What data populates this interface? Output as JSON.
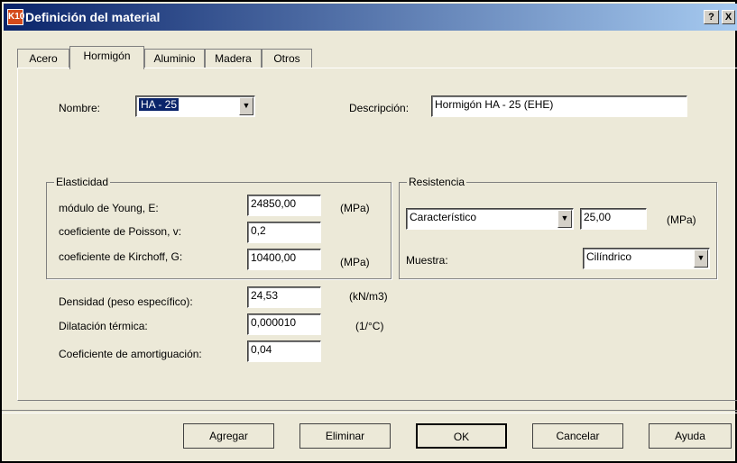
{
  "window": {
    "title": "Definición del material",
    "icon_text": "K10",
    "help_label": "?",
    "close_label": "X"
  },
  "tabs": [
    {
      "label": "Acero"
    },
    {
      "label": "Hormigón",
      "active": true
    },
    {
      "label": "Aluminio"
    },
    {
      "label": "Madera"
    },
    {
      "label": "Otros"
    }
  ],
  "nombre": {
    "label": "Nombre:",
    "value": "HA - 25"
  },
  "descripcion": {
    "label": "Descripción:",
    "value": "Hormigón HA - 25 (EHE)"
  },
  "elasticidad": {
    "title": "Elasticidad",
    "young": {
      "label": "módulo de Young, E:",
      "value": "24850,00",
      "unit": "(MPa)"
    },
    "poisson": {
      "label": "coeficiente de Poisson, v:",
      "value": "0,2"
    },
    "kirchoff": {
      "label": "coeficiente de Kirchoff, G:",
      "value": "10400,00",
      "unit": "(MPa)"
    }
  },
  "resistencia": {
    "title": "Resistencia",
    "tipo": "Característico",
    "valor": "25,00",
    "unit": "(MPa)",
    "muestra_label": "Muestra:",
    "muestra": "Cilíndrico"
  },
  "densidad": {
    "label": "Densidad (peso específico):",
    "value": "24,53",
    "unit": "(kN/m3)"
  },
  "dilatacion": {
    "label": "Dilatación térmica:",
    "value": "0,000010",
    "unit": "(1/°C)"
  },
  "amortiguacion": {
    "label": "Coeficiente de amortiguación:",
    "value": "0,04"
  },
  "buttons": {
    "agregar": "Agregar",
    "eliminar": "Eliminar",
    "ok": "OK",
    "cancelar": "Cancelar",
    "ayuda": "Ayuda"
  },
  "arrow_glyph": "▼"
}
